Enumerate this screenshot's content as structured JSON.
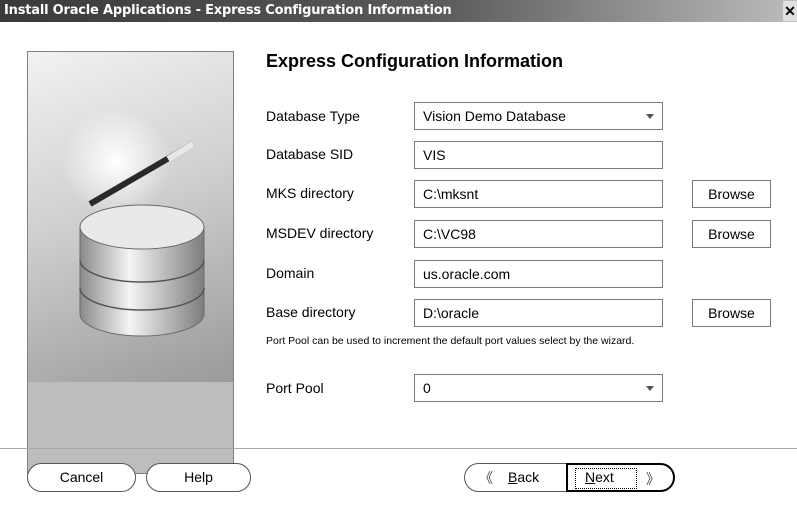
{
  "window": {
    "title": "Install Oracle Applications - Express Configuration Information",
    "close_glyph": "✕"
  },
  "page": {
    "title": "Express Configuration Information"
  },
  "form": {
    "database_type": {
      "label": "Database Type",
      "value": "Vision Demo Database"
    },
    "database_sid": {
      "label": "Database SID",
      "value": "VIS"
    },
    "mks_directory": {
      "label": "MKS directory",
      "value": "C:\\mksnt"
    },
    "msdev_directory": {
      "label": "MSDEV directory",
      "value": "C:\\VC98"
    },
    "domain": {
      "label": "Domain",
      "value": "us.oracle.com"
    },
    "base_directory": {
      "label": "Base directory",
      "value": "D:\\oracle"
    },
    "hint": "Port Pool can be used to increment the default port values select by the wizard.",
    "port_pool": {
      "label": "Port Pool",
      "value": "0"
    },
    "browse_label": "Browse"
  },
  "footer": {
    "cancel": "Cancel",
    "help": "Help",
    "back": "Back",
    "next": "Next"
  },
  "icons": {
    "back": "chevron-double-left-icon",
    "next": "chevron-double-right-icon",
    "dropdown": "dropdown-arrow-icon"
  }
}
